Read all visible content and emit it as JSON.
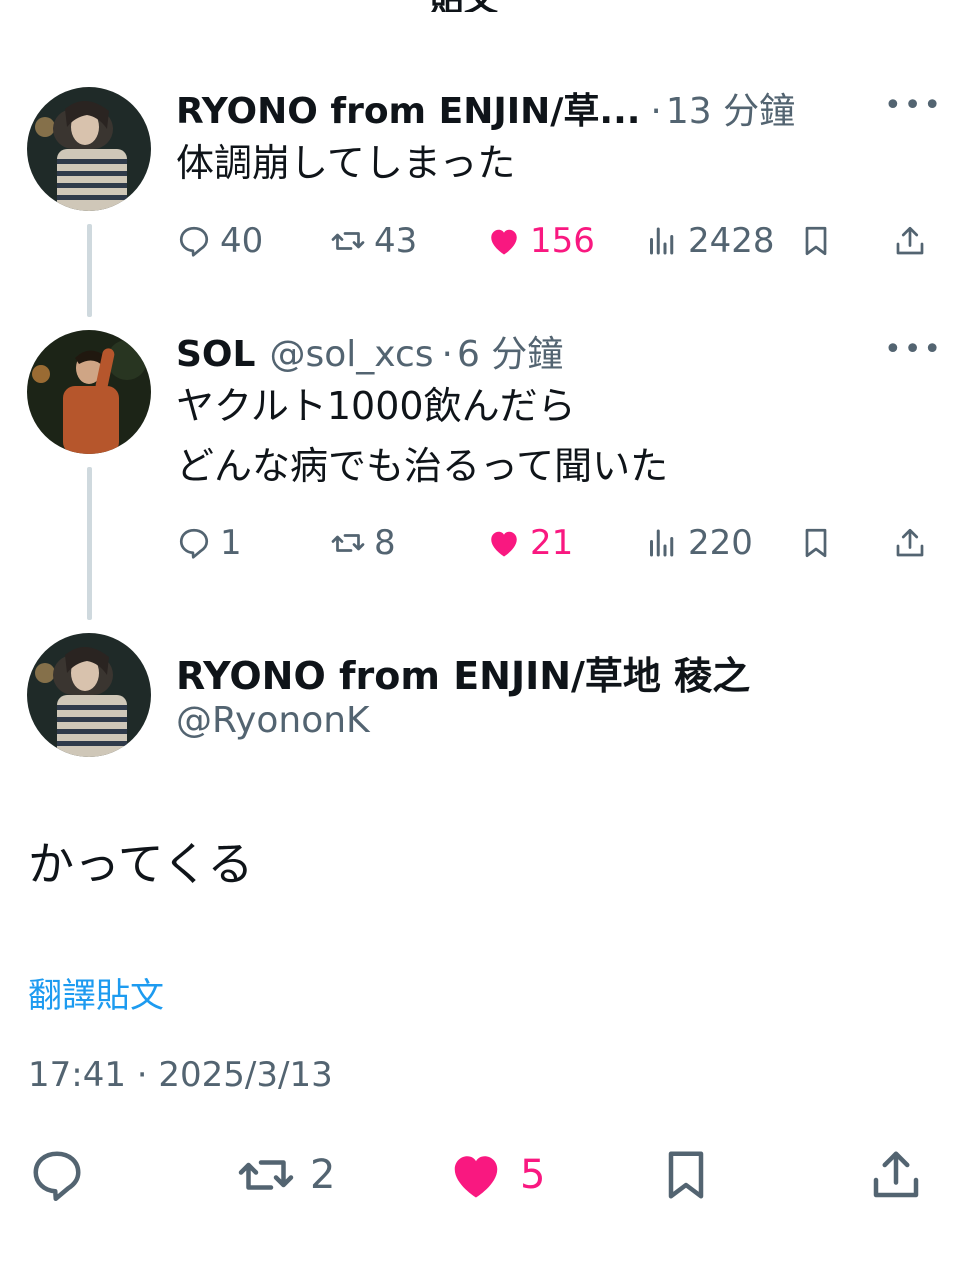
{
  "header": {
    "back_icon": "back-arrow-icon",
    "title": "貼文"
  },
  "thread": [
    {
      "name": "RYONO from ENJIN/草...",
      "handle": "",
      "separator": "·",
      "time": "13 分鐘",
      "text": "体調崩してしまった",
      "more": "•••",
      "replies": "40",
      "reposts": "43",
      "likes": "156",
      "views": "2428"
    },
    {
      "name": "SOL",
      "handle": "@sol_xcs",
      "separator": "·",
      "time": "6 分鐘",
      "text": "ヤクルト1000飲んだら\nどんな病でも治るって聞いた",
      "more": "•••",
      "replies": "1",
      "reposts": "8",
      "likes": "21",
      "views": "220"
    }
  ],
  "main": {
    "name": "RYONO from ENJIN/草地 稜之",
    "handle": "@RyononK",
    "text": "かってくる",
    "translate": "翻譯貼文",
    "timestamp": "17:41 · 2025/3/13",
    "reposts": "2",
    "likes": "5"
  },
  "colors": {
    "like": "#f91880",
    "link": "#1d9bf0",
    "muted": "#536471",
    "thread_line": "#cfd9de"
  }
}
